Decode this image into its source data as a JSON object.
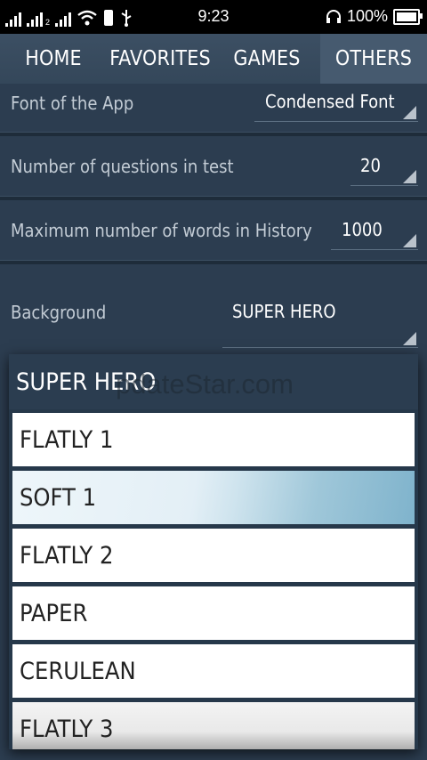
{
  "status_bar": {
    "time": "9:23",
    "battery_percent": "100%",
    "sim2_label": "2",
    "icons": [
      "signal-1-icon",
      "signal-2-icon",
      "wifi-icon",
      "phone-icon",
      "usb-icon",
      "headset-icon",
      "battery-icon"
    ]
  },
  "tabs": [
    {
      "label": "HOME"
    },
    {
      "label": "FAVORITES"
    },
    {
      "label": "GAMES"
    },
    {
      "label": "OTHERS",
      "active": true
    }
  ],
  "settings": {
    "font": {
      "label": "Font of the App",
      "value": "Condensed Font"
    },
    "questions": {
      "label": "Number of questions in test",
      "value": "20"
    },
    "history": {
      "label": "Maximum number of words in History",
      "value": "1000"
    },
    "background": {
      "label": "Background",
      "value": "SUPER HERO"
    }
  },
  "dropdown": {
    "selected": "SUPER HERO",
    "options": [
      "FLATLY 1",
      "SOFT 1",
      "FLATLY 2",
      "PAPER",
      "CERULEAN",
      "FLATLY 3"
    ]
  },
  "watermark": "pdateStar.com"
}
